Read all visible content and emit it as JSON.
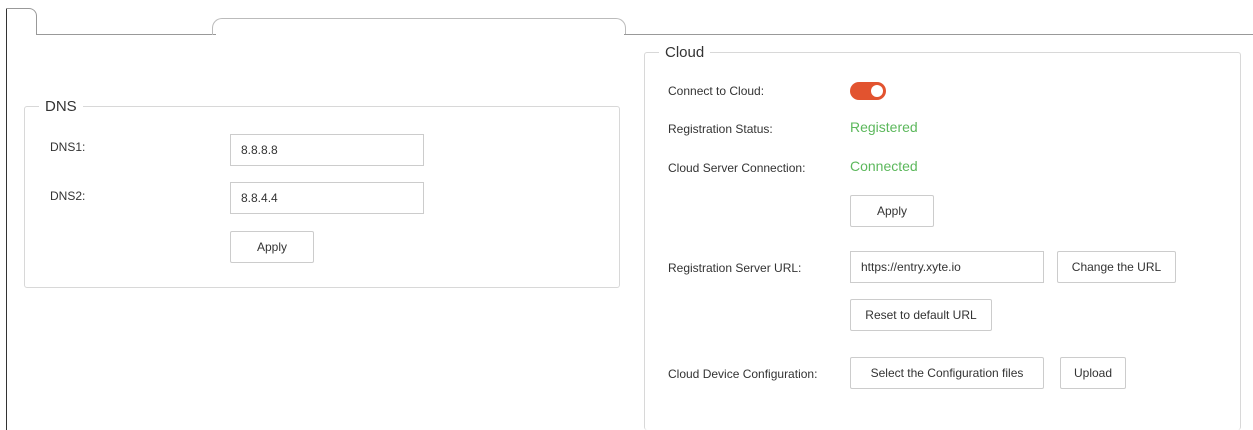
{
  "dns": {
    "legend": "DNS",
    "dns1_label": "DNS1:",
    "dns1_value": "8.8.8.8",
    "dns2_label": "DNS2:",
    "dns2_value": "8.8.4.4",
    "apply_label": "Apply"
  },
  "cloud": {
    "legend": "Cloud",
    "connect_label": "Connect to Cloud:",
    "connect_enabled": true,
    "toggle_color": "#e2532f",
    "registration_status_label": "Registration Status:",
    "registration_status_value": "Registered",
    "server_connection_label": "Cloud Server Connection:",
    "server_connection_value": "Connected",
    "status_color": "#5cb85c",
    "apply_label": "Apply",
    "registration_url_label": "Registration Server URL:",
    "registration_url_value": "https://entry.xyte.io",
    "change_url_label": "Change the URL",
    "reset_url_label": "Reset to default URL",
    "device_config_label": "Cloud Device Configuration:",
    "select_files_label": "Select the Configuration files",
    "upload_label": "Upload"
  }
}
